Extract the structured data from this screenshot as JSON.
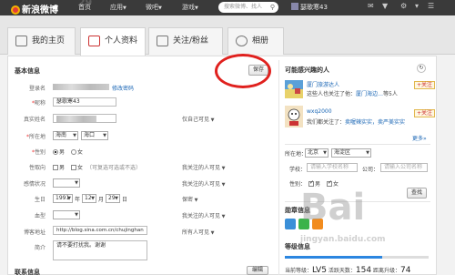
{
  "topnav": {
    "ghost": "29",
    "logo": "新浪微博",
    "items": [
      {
        "label": "首页",
        "arrow": ""
      },
      {
        "label": "应用",
        "arrow": "▼"
      },
      {
        "label": "微吧",
        "arrow": "▼"
      },
      {
        "label": "游戏",
        "arrow": "▼"
      }
    ],
    "search_placeholder": "搜索微博、找人",
    "username": "瑟歌寒43"
  },
  "tabs": [
    {
      "label": "我的主页"
    },
    {
      "label": "个人资料"
    },
    {
      "label": "关注/粉丝"
    },
    {
      "label": "相册"
    }
  ],
  "basic": {
    "title": "基本信息",
    "save": "保存",
    "login_label": "登录名",
    "modify_pwd": "修改密码",
    "nickname_label": "昵称",
    "nickname": "瑟歌寒43",
    "realname_label": "真实姓名",
    "realname_privacy": "仅自己可见",
    "location_label": "所在地",
    "province": "海南",
    "city": "海口",
    "gender_label": "性别",
    "male": "男",
    "female": "女",
    "orientation_label": "性取向",
    "orientation_male": "男",
    "orientation_female": "女",
    "orientation_hint": "（可复选可选或不选）",
    "orientation_privacy": "我关注的人可见",
    "relationship_label": "感情状况",
    "relationship_privacy": "我关注的人可见",
    "birthday_label": "生日",
    "year": "1991",
    "year_unit": "年",
    "month": "12",
    "month_unit": "月",
    "day": "29",
    "day_unit": "日",
    "birthday_privacy": "保密",
    "blood_label": "血型",
    "blood_privacy": "我关注的人可见",
    "blog_label": "博客地址",
    "blog_value": "http://blog.sina.com.cn/chujinghan",
    "blog_privacy": "所有人可见",
    "intro_label": "简介",
    "intro_value": "请不要打扰我。谢谢"
  },
  "contact": {
    "title": "联系信息",
    "edit": "编辑"
  },
  "side": {
    "title": "可能感兴趣的人",
    "people": [
      {
        "name": "厦门旅游达人",
        "reason": "这些人也关注了他：",
        "mutual": "厦门海边…",
        "more": "等5人",
        "follow": "+关注"
      },
      {
        "name": "wxq2000",
        "reason": "我们都关注了：",
        "mutual": "卖喔辣实实，卖严美实实",
        "follow": "+关注"
      }
    ],
    "more_link": "更多»",
    "region_label": "所在地：",
    "region_province": "北京",
    "region_district": "海淀区",
    "school_label": "学校：",
    "school_placeholder": "请输入学校名称",
    "company_label": "公司：",
    "company_placeholder": "请输入公司名称",
    "gender_label": "性别：",
    "male": "男",
    "female": "女",
    "search_btn": "查找",
    "medal_title": "勋章信息",
    "level_title": "等级信息",
    "level_label": "当前等级：",
    "level": "LV5",
    "active_days_label": "活跃天数：",
    "active_days": "154",
    "next_label": "距离升级：",
    "next_days": "74",
    "level_progress": 0.68
  },
  "watermark": {
    "main": "Bai",
    "domain": "jingyan.baidu.com"
  }
}
